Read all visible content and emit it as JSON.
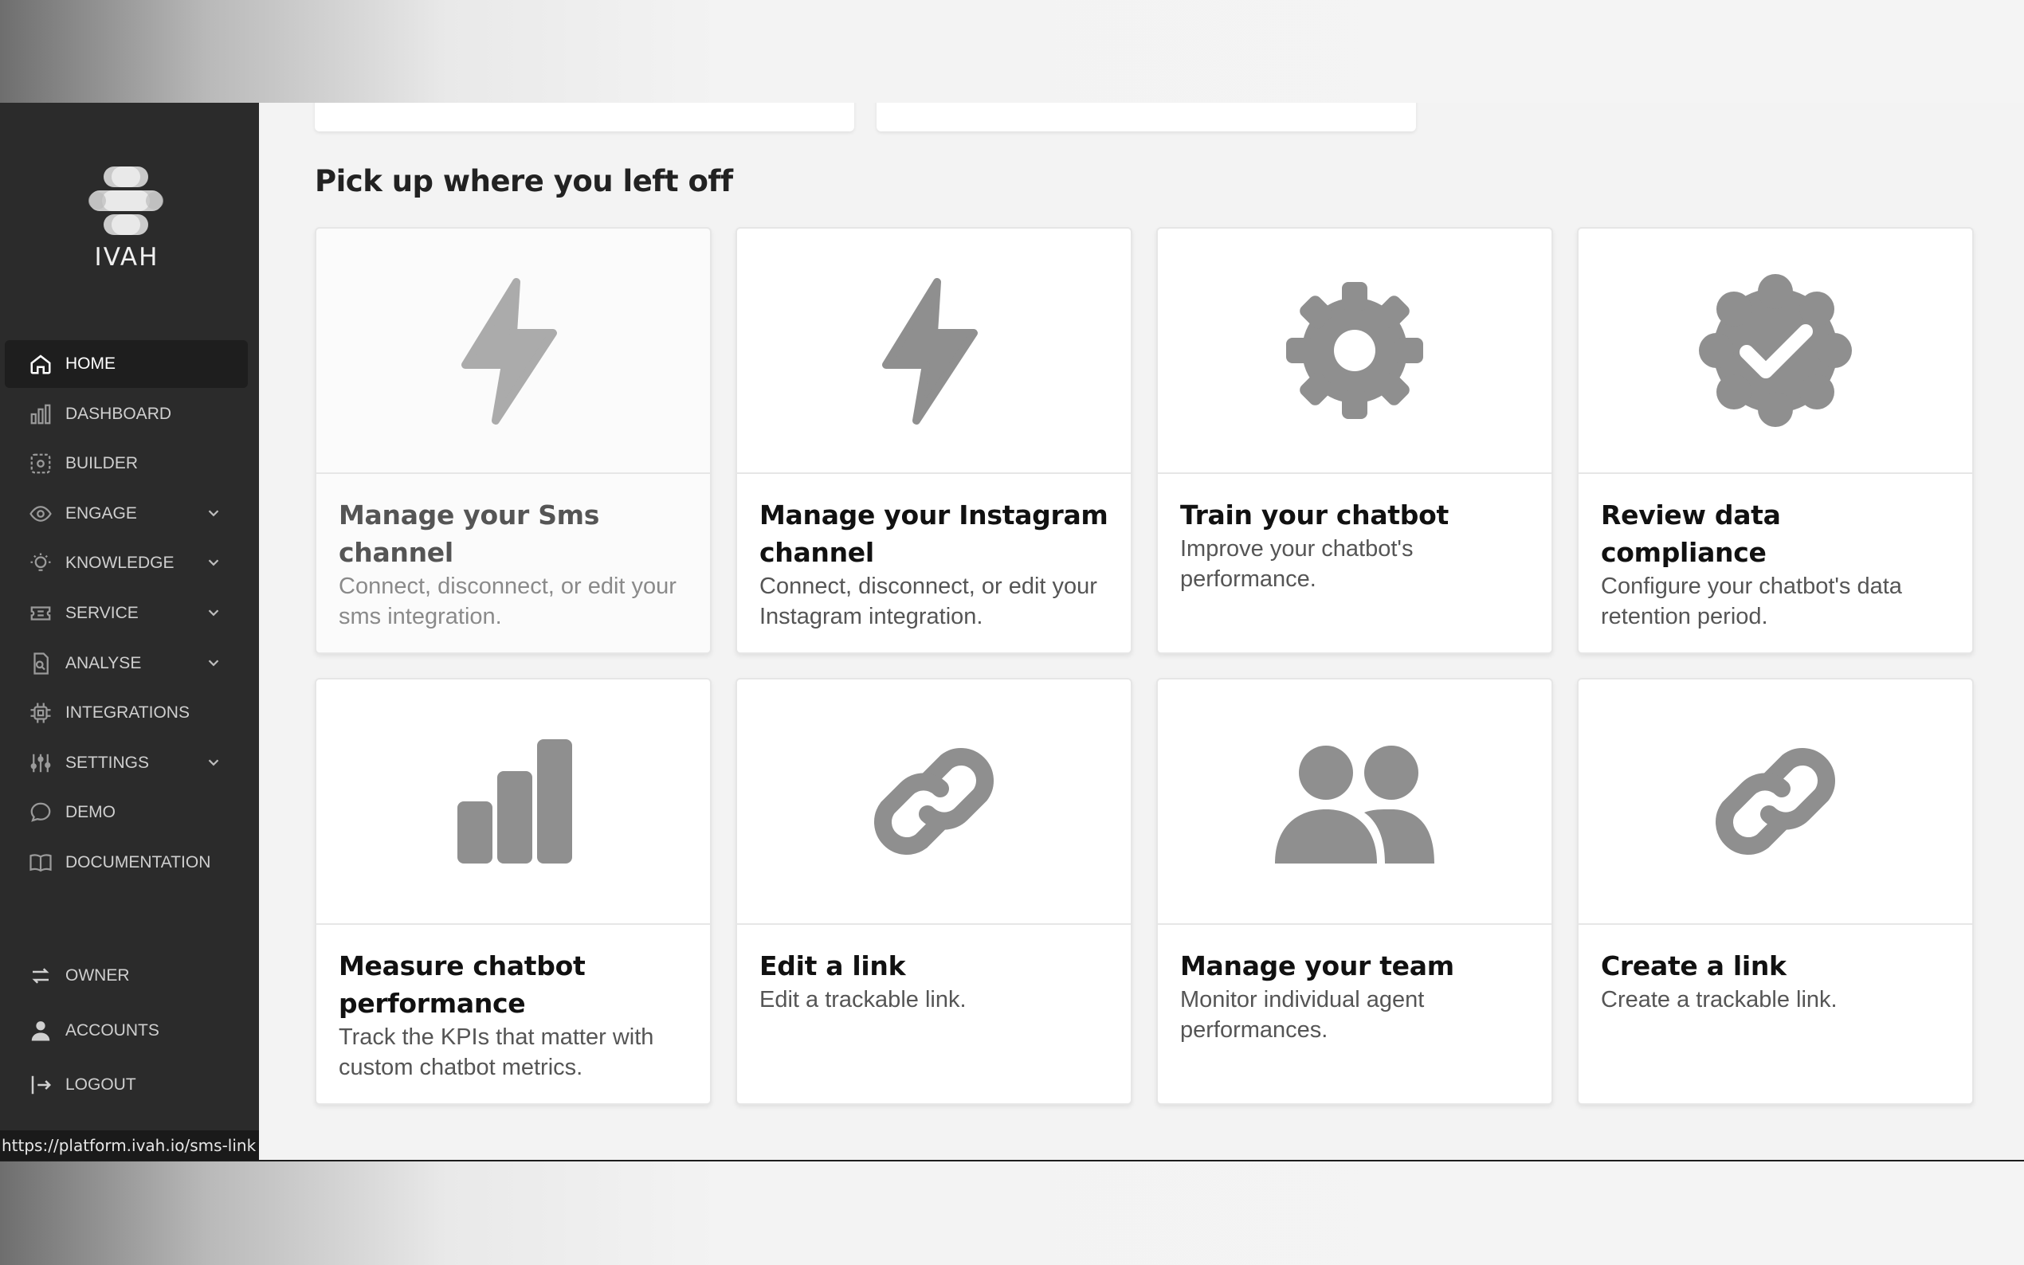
{
  "brand": {
    "name": "IVAH"
  },
  "nav": {
    "items": [
      {
        "label": "HOME",
        "icon": "home-icon",
        "active": true,
        "expandable": false
      },
      {
        "label": "DASHBOARD",
        "icon": "bar-chart-icon",
        "active": false,
        "expandable": false
      },
      {
        "label": "BUILDER",
        "icon": "builder-icon",
        "active": false,
        "expandable": false
      },
      {
        "label": "ENGAGE",
        "icon": "eye-icon",
        "active": false,
        "expandable": true
      },
      {
        "label": "KNOWLEDGE",
        "icon": "lightbulb-icon",
        "active": false,
        "expandable": true
      },
      {
        "label": "SERVICE",
        "icon": "ticket-icon",
        "active": false,
        "expandable": true
      },
      {
        "label": "ANALYSE",
        "icon": "report-icon",
        "active": false,
        "expandable": true
      },
      {
        "label": "INTEGRATIONS",
        "icon": "chip-icon",
        "active": false,
        "expandable": false
      },
      {
        "label": "SETTINGS",
        "icon": "sliders-icon",
        "active": false,
        "expandable": true
      },
      {
        "label": "DEMO",
        "icon": "chat-bubble-icon",
        "active": false,
        "expandable": false
      },
      {
        "label": "DOCUMENTATION",
        "icon": "book-icon",
        "active": false,
        "expandable": false
      }
    ],
    "bottom": [
      {
        "label": "OWNER",
        "icon": "swap-icon"
      },
      {
        "label": "ACCOUNTS",
        "icon": "user-icon"
      },
      {
        "label": "LOGOUT",
        "icon": "logout-icon"
      }
    ]
  },
  "status_url": "https://platform.ivah.io/sms-link",
  "main": {
    "section_title": "Pick up where you left off",
    "cards": [
      {
        "title": "Manage your Sms channel",
        "desc": "Connect, disconnect, or edit your sms integration.",
        "icon": "lightning-icon",
        "dim": true
      },
      {
        "title": "Manage your Instagram channel",
        "desc": "Connect, disconnect, or edit your Instagram integration.",
        "icon": "lightning-icon",
        "dim": false
      },
      {
        "title": "Train your chatbot",
        "desc": "Improve your chatbot's performance.",
        "icon": "gear-icon",
        "dim": false
      },
      {
        "title": "Review data compliance",
        "desc": "Configure your chatbot's data retention period.",
        "icon": "check-badge-icon",
        "dim": false
      },
      {
        "title": "Measure chatbot performance",
        "desc": "Track the KPIs that matter with custom chatbot metrics.",
        "icon": "bar-chart-icon",
        "dim": false
      },
      {
        "title": "Edit a link",
        "desc": "Edit a trackable link.",
        "icon": "link-icon",
        "dim": false
      },
      {
        "title": "Manage your team",
        "desc": "Monitor individual agent performances.",
        "icon": "team-icon",
        "dim": false
      },
      {
        "title": "Create a link",
        "desc": "Create a trackable link.",
        "icon": "link-icon",
        "dim": false
      }
    ]
  },
  "colors": {
    "sidebar": "#2b2b2b",
    "active_nav": "#1e1e1e",
    "icon_gray": "#909090",
    "icon_light": "#ababab",
    "page_bg": "#f3f3f3"
  }
}
